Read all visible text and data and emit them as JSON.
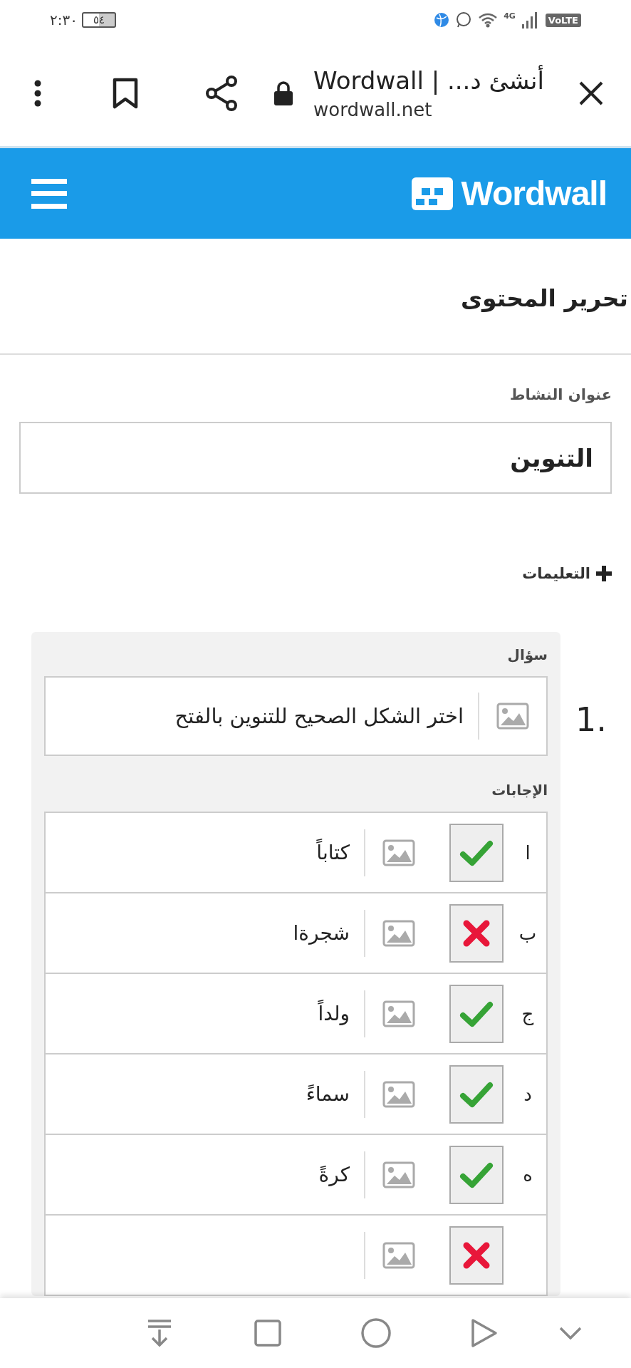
{
  "status_bar": {
    "time": "٢:٣٠",
    "battery": "٥٤",
    "network": "4G",
    "volte": "VoLTE"
  },
  "browser": {
    "title": "أنشئ د... | Wordwall",
    "url": "wordwall.net"
  },
  "header": {
    "logo": "Wordwall"
  },
  "page_title": "تحرير المحتوى",
  "activity_title": {
    "label": "عنوان النشاط",
    "value": "التنوين"
  },
  "instructions": {
    "label": "التعليمات",
    "expanded": false
  },
  "questions": [
    {
      "number": "1.",
      "label": "سؤال",
      "text": "اختر الشكل الصحيح للتنوين بالفتح",
      "answers_label": "الإجابات",
      "answers": [
        {
          "letter": "ا",
          "text": "كتاباً",
          "correct": true
        },
        {
          "letter": "ب",
          "text": "شجرةا",
          "correct": false
        },
        {
          "letter": "ج",
          "text": "ولداً",
          "correct": true
        },
        {
          "letter": "د",
          "text": "سماءً",
          "correct": true
        },
        {
          "letter": "ه",
          "text": "كرةً",
          "correct": true
        },
        {
          "correct": false
        }
      ]
    }
  ]
}
